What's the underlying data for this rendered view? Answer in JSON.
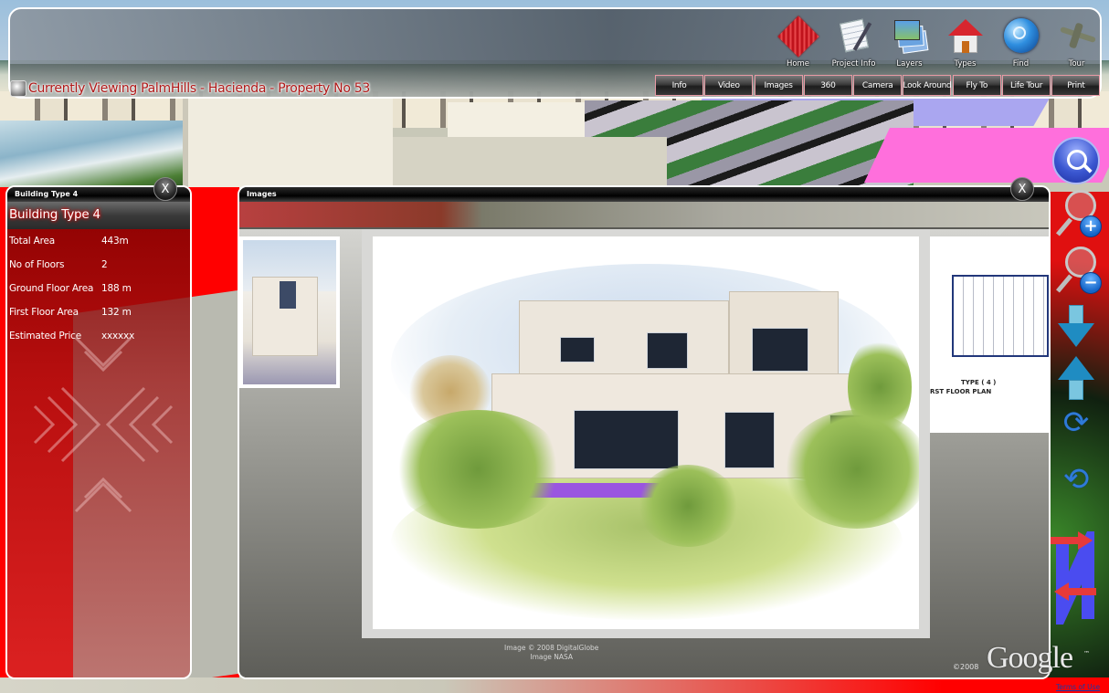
{
  "header": {
    "viewing_text": "Currently Viewing PalmHills - Hacienda - Property No 53"
  },
  "main_toolbar": [
    {
      "icon": "home-icon",
      "label": "Home"
    },
    {
      "icon": "project-info-icon",
      "label": "Project Info"
    },
    {
      "icon": "layers-icon",
      "label": "Layers"
    },
    {
      "icon": "types-icon",
      "label": "Types"
    },
    {
      "icon": "find-icon",
      "label": "Find"
    },
    {
      "icon": "tour-icon",
      "label": "Tour"
    }
  ],
  "sub_toolbar": [
    "Info",
    "Video",
    "Images",
    "360",
    "Camera",
    "Look Around",
    "Fly To",
    "Life Tour",
    "Print"
  ],
  "info_panel": {
    "title": "Building Type 4",
    "heading": "Building Type 4",
    "close_label": "X",
    "rows": [
      {
        "label": "Total Area",
        "value": "443m"
      },
      {
        "label": "No of Floors",
        "value": "2"
      },
      {
        "label": "Ground Floor Area",
        "value": "188 m"
      },
      {
        "label": "First Floor Area",
        "value": "132 m"
      },
      {
        "label": "Estimated Price",
        "value": "xxxxxx"
      }
    ]
  },
  "images_panel": {
    "title": "Images",
    "close_label": "X",
    "plan_caption_line1": "TYPE ( 4 )",
    "plan_caption_line2": "RST FLOOR PLAN",
    "attribution_line1": "Image © 2008 DigitalGlobe",
    "attribution_line2": "Image NASA"
  },
  "nav_controls": {
    "zoom_in_symbol": "+",
    "zoom_out_symbol": "−",
    "rotate_cw_symbol": "⟳",
    "rotate_ccw_symbol": "⟲"
  },
  "footer": {
    "google_logo": "Google",
    "trademark": "™",
    "copyright": "©2008",
    "terms_link": "Terms of Use"
  },
  "colors": {
    "viewing_text": "#b01818",
    "toolbar_button_border": "#e89aa5",
    "info_panel_bg": "#800000",
    "nav_blue": "#2f7ad8",
    "north_arrow_blue": "#4a4cf0",
    "north_arrow_red": "#e63a3a"
  }
}
